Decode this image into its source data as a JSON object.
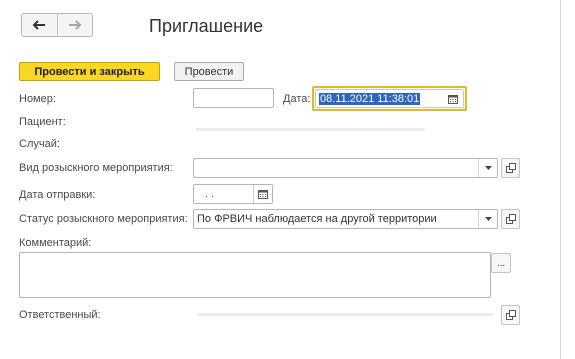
{
  "header": {
    "title": "Приглашение"
  },
  "toolbar": {
    "post_close_label": "Провести и закрыть",
    "post_label": "Провести"
  },
  "form": {
    "number_label": "Номер:",
    "number_value": "",
    "date_label": "Дата:",
    "date_value": "08.11.2021 11:38:01",
    "patient_label": "Пациент:",
    "case_label": "Случай:",
    "search_type_label": "Вид розыскного мероприятия:",
    "search_type_value": "",
    "send_date_label": "Дата отправки:",
    "send_date_value": ". .",
    "status_label": "Статус розыскного мероприятия:",
    "status_value": "По ФРВИЧ наблюдается на другой территории",
    "comment_label": "Комментарий:",
    "comment_value": "",
    "responsible_label": "Ответственный:",
    "responsible_value": "",
    "comment_button": "..."
  },
  "icons": {
    "back": "arrow-left-icon",
    "forward": "arrow-right-icon",
    "calendar": "calendar-icon",
    "dropdown": "chevron-down-icon",
    "open": "open-form-icon"
  },
  "colors": {
    "primary_button": "#fbd623",
    "focus_border": "#e8b81c",
    "selection": "#2f63c4"
  }
}
